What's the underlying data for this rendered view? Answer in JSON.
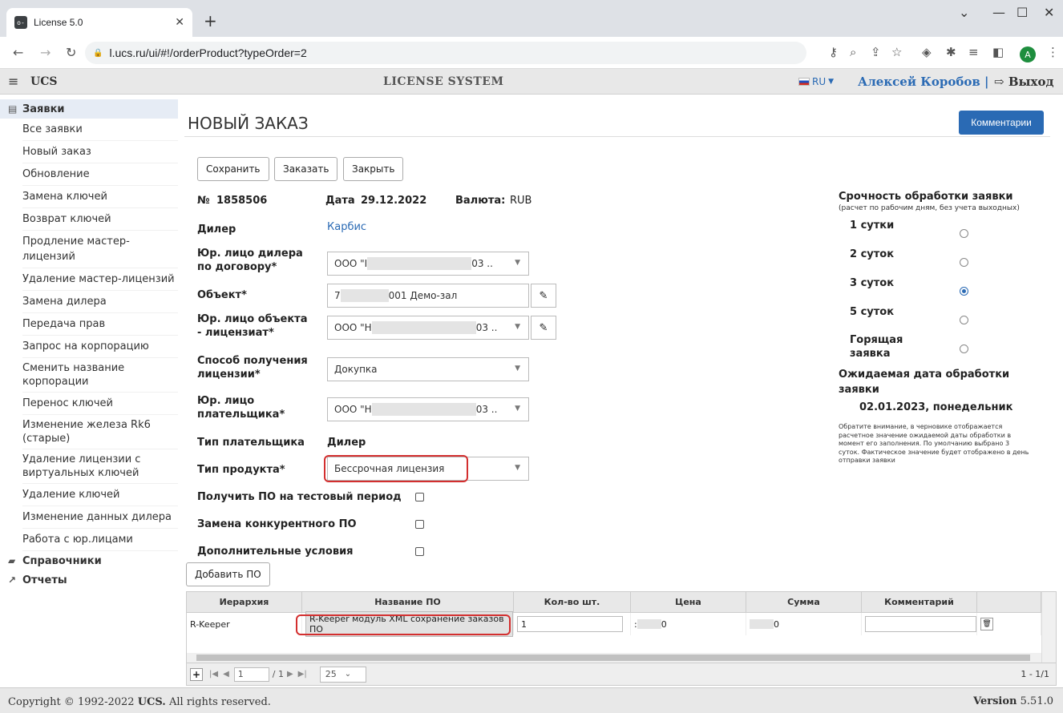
{
  "browser": {
    "tab_title": "License 5.0",
    "tab_favicon": "key-favicon",
    "new_tab": "+",
    "url": "l.ucs.ru/ui/#!/orderProduct?typeOrder=2",
    "avatar_letter": "A"
  },
  "header": {
    "brand": "UCS",
    "system": "LICENSE SYSTEM",
    "lang": "RU",
    "user": "Алексей Коробов |",
    "exit": "Выход"
  },
  "sidebar": {
    "group_orders": "Заявки",
    "items": [
      "Все заявки",
      "Новый заказ",
      "Обновление",
      "Замена ключей",
      "Возврат ключей",
      "Продление мастер-лицензий",
      "Удаление мастер-лицензий",
      "Замена дилера",
      "Передача прав",
      "Запрос на корпорацию",
      "Сменить название корпорации",
      "Перенос ключей",
      "Изменение железа Rk6 (старые)",
      "Удаление лицензии с виртуальных ключей",
      "Удаление ключей",
      "Изменение данных дилера",
      "Работа с юр.лицами"
    ],
    "group_refs": "Справочники",
    "group_reports": "Отчеты"
  },
  "page": {
    "title": "НОВЫЙ ЗАКАЗ",
    "comments_btn": "Комментарии",
    "save_btn": "Сохранить",
    "order_btn": "Заказать",
    "close_btn": "Закрыть"
  },
  "form": {
    "no_label": "№",
    "no_value": "1858506",
    "date_label": "Дата",
    "date_value": "29.12.2022",
    "currency_label": "Валюта:",
    "currency_value": "RUB",
    "dealer_label": "Дилер",
    "dealer_value": "Карбис",
    "dealer_entity_label": "Юр. лицо дилера по договору*",
    "dealer_entity_pre": "ООО \"I",
    "dealer_entity_post": "03 ..",
    "object_label": "Объект*",
    "object_pre": "7",
    "object_post": "001 Демо-зал",
    "licensee_label": "Юр. лицо объекта - лицензиат*",
    "licensee_pre": "ООО \"Н",
    "licensee_post": "03 ..",
    "method_label": "Способ получения лицензии*",
    "method_value": "Докупка",
    "payer_label": "Юр. лицо плательщика*",
    "payer_pre": "ООО \"Н",
    "payer_post": "03 ..",
    "payer_type_label": "Тип плательщика",
    "payer_type_value": "Дилер",
    "product_type_label": "Тип продукта*",
    "product_type_value": "Бессрочная лицензия",
    "trial_label": "Получить ПО на тестовый период",
    "competitor_label": "Замена конкурентного ПО",
    "extra_label": "Дополнительные условия",
    "add_btn": "Добавить ПО"
  },
  "urgency": {
    "title": "Срочность обработки заявки",
    "subtitle": "(расчет по рабочим дням, без учета выходных)",
    "options": [
      "1 сутки",
      "2 суток",
      "3 суток",
      "5 суток",
      "Горящая заявка"
    ],
    "selected_index": 2,
    "expected_title": "Ожидаемая дата обработки заявки",
    "expected_date": "02.01.2023, понедельник",
    "note": "Обратите внимание, в черновике отображается расчетное значение ожидаемой даты обработки в момент его заполнения. По умолчанию выбрано 3 суток. Фактическое значение будет отображено в день отправки заявки"
  },
  "grid": {
    "columns": [
      "Иерархия",
      "Название ПО",
      "Кол-во шт.",
      "Цена",
      "Сумма",
      "Комментарий"
    ],
    "row": {
      "hierarchy": "R-Keeper",
      "name": "R-Keeper модуль XML сохранение заказов ПО",
      "qty": "1",
      "price_pre": ":",
      "price_post": "0",
      "sum_post": "0"
    },
    "pager": {
      "page": "1",
      "of": "/ 1",
      "size": "25",
      "count": "1 - 1/1"
    }
  },
  "footer": {
    "copy_prefix": "Copyright © 1992-2022",
    "copy_brand": "UCS.",
    "copy_suffix": "All rights reserved.",
    "version_label": "Version",
    "version_value": "5.51.0"
  },
  "colors": {
    "accent": "#2a6ab4",
    "highlight": "#d32f2f"
  }
}
